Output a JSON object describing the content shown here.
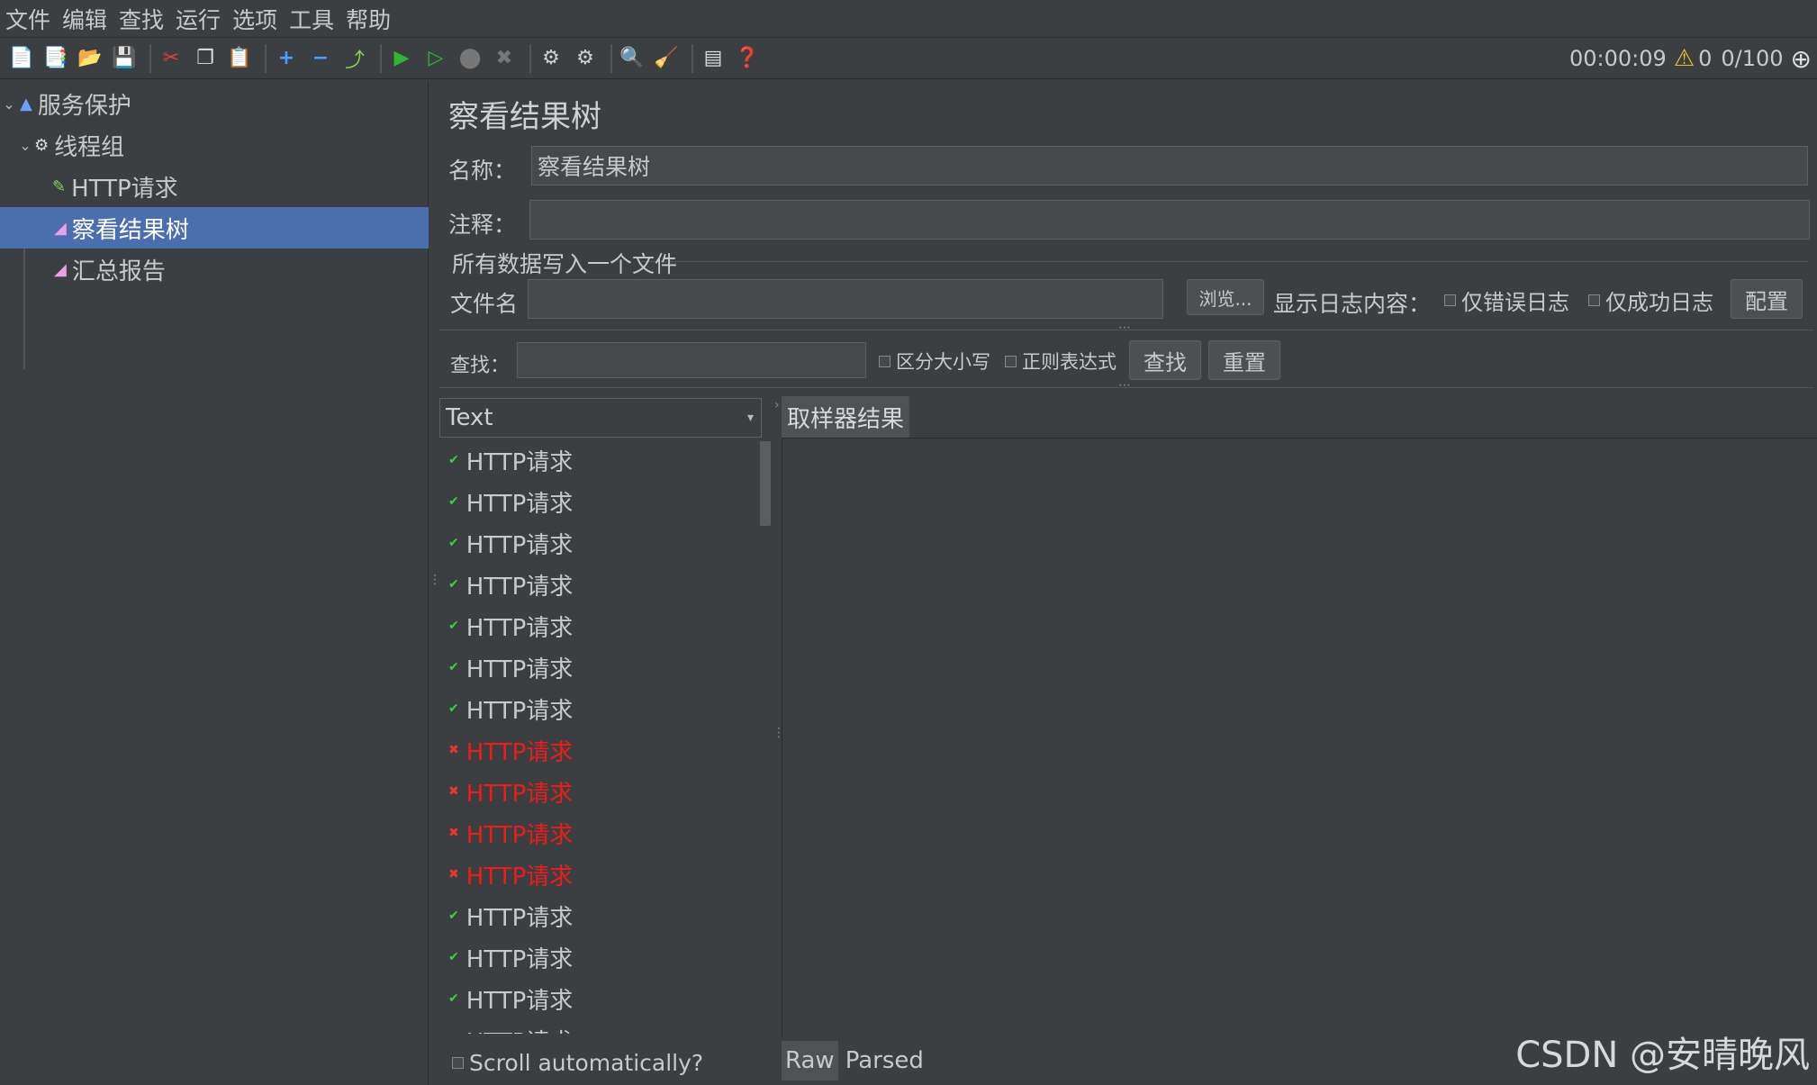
{
  "menu": [
    "文件",
    "编辑",
    "查找",
    "运行",
    "选项",
    "工具",
    "帮助"
  ],
  "toolbar": {
    "icons": [
      "new-icon",
      "templates-icon",
      "open-icon",
      "save-icon",
      "cut-icon",
      "copy-icon",
      "paste-icon",
      "expand-icon",
      "collapse-icon",
      "toggle-icon",
      "start-icon",
      "start-no-pause-icon",
      "stop-icon",
      "shutdown-icon",
      "remote-start-icon",
      "remote-stop-icon",
      "clear-icon",
      "clear-all-icon",
      "function-helper-icon",
      "help-icon"
    ]
  },
  "status": {
    "timer": "00:00:09",
    "warnings": "0",
    "threads": "0/100"
  },
  "tree": {
    "items": [
      {
        "label": "服务保护",
        "icon": "flask-icon",
        "level": 0
      },
      {
        "label": "线程组",
        "icon": "gear-icon",
        "level": 1
      },
      {
        "label": "HTTP请求",
        "icon": "pencil-icon",
        "level": 2
      },
      {
        "label": "察看结果树",
        "icon": "chart-icon",
        "level": 2,
        "selected": true
      },
      {
        "label": "汇总报告",
        "icon": "chart-icon",
        "level": 2
      }
    ]
  },
  "panel": {
    "title": "察看结果树",
    "name_label": "名称：",
    "name_value": "察看结果树",
    "comment_label": "注释：",
    "comment_value": "",
    "file_section": "所有数据写入一个文件",
    "filename_label": "文件名",
    "filename_value": "",
    "browse_label": "浏览...",
    "log_label": "显示日志内容：",
    "errors_only": "仅错误日志",
    "success_only": "仅成功日志",
    "configure_label": "配置",
    "search_label": "查找：",
    "search_value": "",
    "case_sensitive": "区分大小写",
    "regex": "正则表达式",
    "find_button": "查找",
    "reset_button": "重置"
  },
  "results": {
    "renderer": "Text",
    "tab_label": "取样器结果",
    "scroll_auto": "Scroll automatically?",
    "bottom_tabs": [
      "Raw",
      "Parsed"
    ],
    "items": [
      {
        "label": "HTTP请求",
        "status": "ok"
      },
      {
        "label": "HTTP请求",
        "status": "ok"
      },
      {
        "label": "HTTP请求",
        "status": "ok"
      },
      {
        "label": "HTTP请求",
        "status": "ok"
      },
      {
        "label": "HTTP请求",
        "status": "ok"
      },
      {
        "label": "HTTP请求",
        "status": "ok"
      },
      {
        "label": "HTTP请求",
        "status": "ok"
      },
      {
        "label": "HTTP请求",
        "status": "error"
      },
      {
        "label": "HTTP请求",
        "status": "error"
      },
      {
        "label": "HTTP请求",
        "status": "error"
      },
      {
        "label": "HTTP请求",
        "status": "error"
      },
      {
        "label": "HTTP请求",
        "status": "ok"
      },
      {
        "label": "HTTP请求",
        "status": "ok"
      },
      {
        "label": "HTTP请求",
        "status": "ok"
      },
      {
        "label": "HTTP请求",
        "status": "ok"
      }
    ]
  },
  "watermark": "CSDN @安晴晚风",
  "colors": {
    "background": "#3c3f41",
    "selection": "#4b6eaf",
    "error": "#ee1b1b",
    "ok": "#3fcf3f"
  }
}
